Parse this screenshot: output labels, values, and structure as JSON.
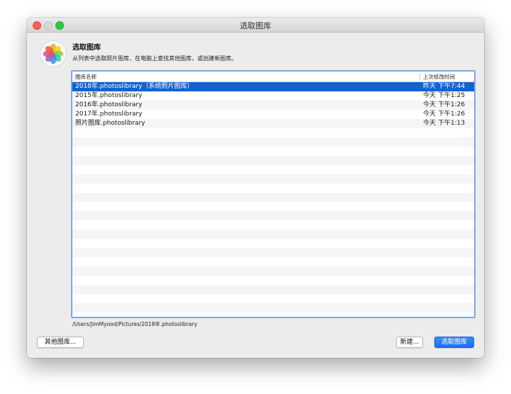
{
  "window": {
    "title": "选取图库"
  },
  "dialog": {
    "heading": "选取图库",
    "description": "从列表中选取照片图库、在电脑上查找其他图库，或创建新图库。"
  },
  "table": {
    "columns": [
      "图库名称",
      "上次修改时间"
    ],
    "rows": [
      {
        "name": "2018年.photoslibrary（系统照片图库）",
        "modified": "昨天 下午7:44",
        "selected": true
      },
      {
        "name": "2015年.photoslibrary",
        "modified": "今天 下午1:25",
        "selected": false
      },
      {
        "name": "2016年.photoslibrary",
        "modified": "今天 下午1:26",
        "selected": false
      },
      {
        "name": "2017年.photoslibrary",
        "modified": "今天 下午1:26",
        "selected": false
      },
      {
        "name": "照片图库.photoslibrary",
        "modified": "今天 下午1:13",
        "selected": false
      }
    ]
  },
  "path": "/Users/JimMyood/Pictures/2018年.photoslibrary",
  "buttons": {
    "other": "其他图库...",
    "new": "新建...",
    "choose": "选取图库"
  },
  "icons": {
    "app": "photos-app-icon"
  },
  "colors": {
    "selection": "#0f64d2",
    "focus_ring": "#7ea6e0",
    "default_button": "#1a6ff0"
  }
}
